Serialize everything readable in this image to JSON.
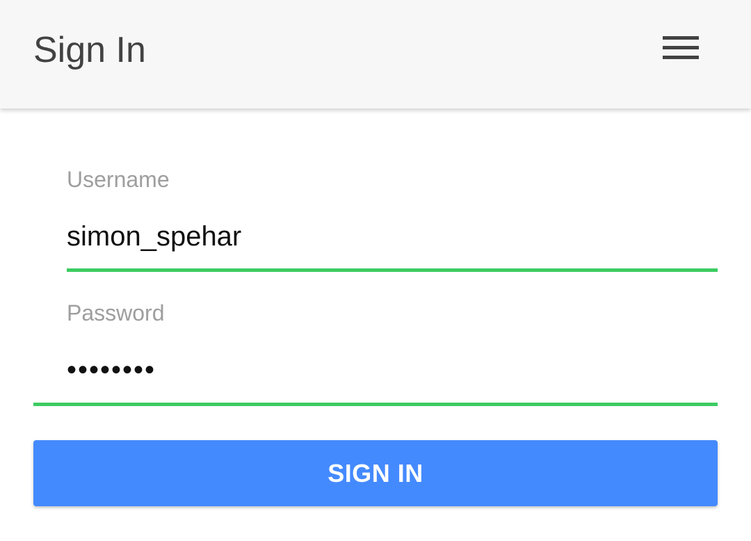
{
  "app_bar": {
    "title": "Sign In",
    "menu_icon": "hamburger-menu-icon"
  },
  "form": {
    "username": {
      "label": "Username",
      "value": "simon_spehar"
    },
    "password": {
      "label": "Password",
      "value": "simon123"
    },
    "submit_label": "SIGN IN"
  },
  "colors": {
    "app_bar_background": "#f7f7f7",
    "title_text": "#424242",
    "field_underline_active": "#3ccc62",
    "button_background": "#448aff",
    "button_text": "#ffffff",
    "label_text": "#9e9e9e"
  }
}
